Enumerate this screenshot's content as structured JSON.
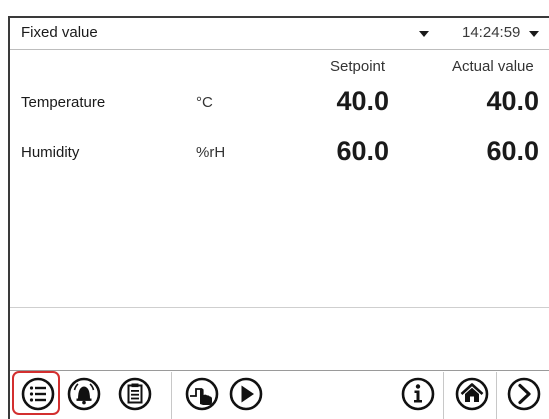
{
  "header": {
    "mode": "Fixed value",
    "time": "14:24:59"
  },
  "columns": {
    "setpoint": "Setpoint",
    "actual": "Actual value"
  },
  "rows": [
    {
      "label": "Temperature",
      "unit": "°C",
      "setpoint": "40.0",
      "actual": "40.0"
    },
    {
      "label": "Humidity",
      "unit": "%rH",
      "setpoint": "60.0",
      "actual": "60.0"
    }
  ],
  "toolbar": {
    "selected": "menu",
    "accent_color": "#d32f2f",
    "icons": [
      "menu-icon",
      "alarm-bell-icon",
      "clipboard-icon",
      "hand-touch-icon",
      "play-icon",
      "info-icon",
      "home-icon",
      "next-arrow-icon"
    ]
  }
}
